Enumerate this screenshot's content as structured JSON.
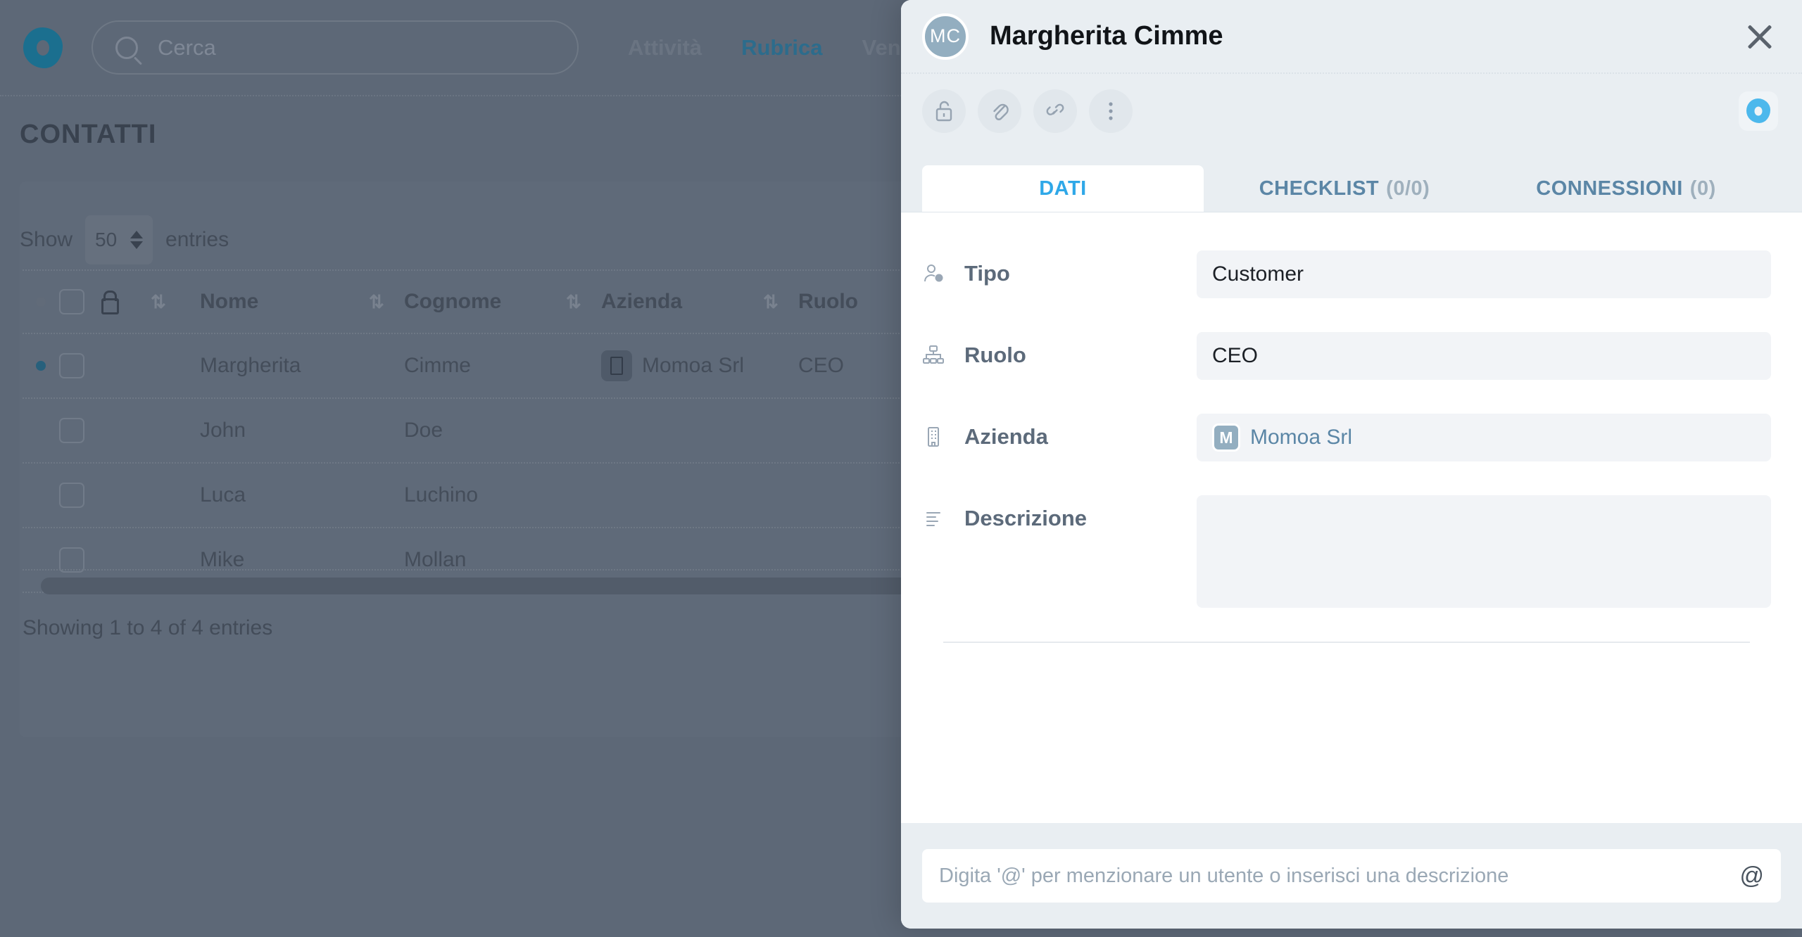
{
  "background": {
    "logo_icon": "app-logo-icon",
    "search": {
      "placeholder": "Cerca",
      "icon": "search-icon"
    },
    "nav": [
      {
        "label": "Attività",
        "active": false
      },
      {
        "label": "Rubrica",
        "active": true
      },
      {
        "label": "Ven",
        "active": false
      }
    ],
    "page_title": "CONTATTI",
    "length_menu": {
      "prefix": "Show",
      "value": "50",
      "suffix": "entries"
    },
    "table": {
      "columns": [
        "Nome",
        "Cognome",
        "Azienda",
        "Ruolo"
      ],
      "lock_icon": "lock-icon",
      "sort_icon": "sort-updown-icon",
      "rows": [
        {
          "nome": "Margherita",
          "cognome": "Cimme",
          "azienda": "Momoa Srl",
          "ruolo": "CEO",
          "selected": true
        },
        {
          "nome": "John",
          "cognome": "Doe",
          "azienda": "",
          "ruolo": "",
          "selected": false
        },
        {
          "nome": "Luca",
          "cognome": "Luchino",
          "azienda": "",
          "ruolo": "",
          "selected": false
        },
        {
          "nome": "Mike",
          "cognome": "Mollan",
          "azienda": "",
          "ruolo": "",
          "selected": false
        }
      ]
    },
    "showing_info": "Showing 1 to 4 of 4 entries"
  },
  "panel": {
    "avatar_initials": "MC",
    "title": "Margherita Cimme",
    "close_icon": "close-icon",
    "tools": [
      {
        "name": "unlock-icon",
        "label": "Unlock"
      },
      {
        "name": "paperclip-icon",
        "label": "Allegati"
      },
      {
        "name": "link-icon",
        "label": "Link"
      },
      {
        "name": "more-vertical-icon",
        "label": "Altro"
      }
    ],
    "brand_badge_icon": "app-logo-icon",
    "tabs": [
      {
        "label": "DATI",
        "count": "",
        "active": true
      },
      {
        "label": "CHECKLIST",
        "count": "(0/0)",
        "active": false
      },
      {
        "label": "CONNESSIONI",
        "count": "(0)",
        "active": false
      }
    ],
    "fields": [
      {
        "icon": "person-tag-icon",
        "label": "Tipo",
        "value": "Customer",
        "type": "text"
      },
      {
        "icon": "org-chart-icon",
        "label": "Ruolo",
        "value": "CEO",
        "type": "text"
      },
      {
        "icon": "building-icon",
        "label": "Azienda",
        "value": "Momoa Srl",
        "badge": "M",
        "type": "chip"
      },
      {
        "icon": "text-lines-icon",
        "label": "Descrizione",
        "value": "",
        "type": "textarea"
      }
    ],
    "footer": {
      "placeholder": "Digita '@' per menzionare un utente o inserisci una descrizione",
      "at_icon": "at-icon",
      "at_glyph": "@"
    }
  },
  "colors": {
    "accent_blue": "#2fa8e8",
    "tab_inactive": "#5b86a6",
    "panel_header_bg": "#e9eef2",
    "backdrop": "#5d6877"
  }
}
